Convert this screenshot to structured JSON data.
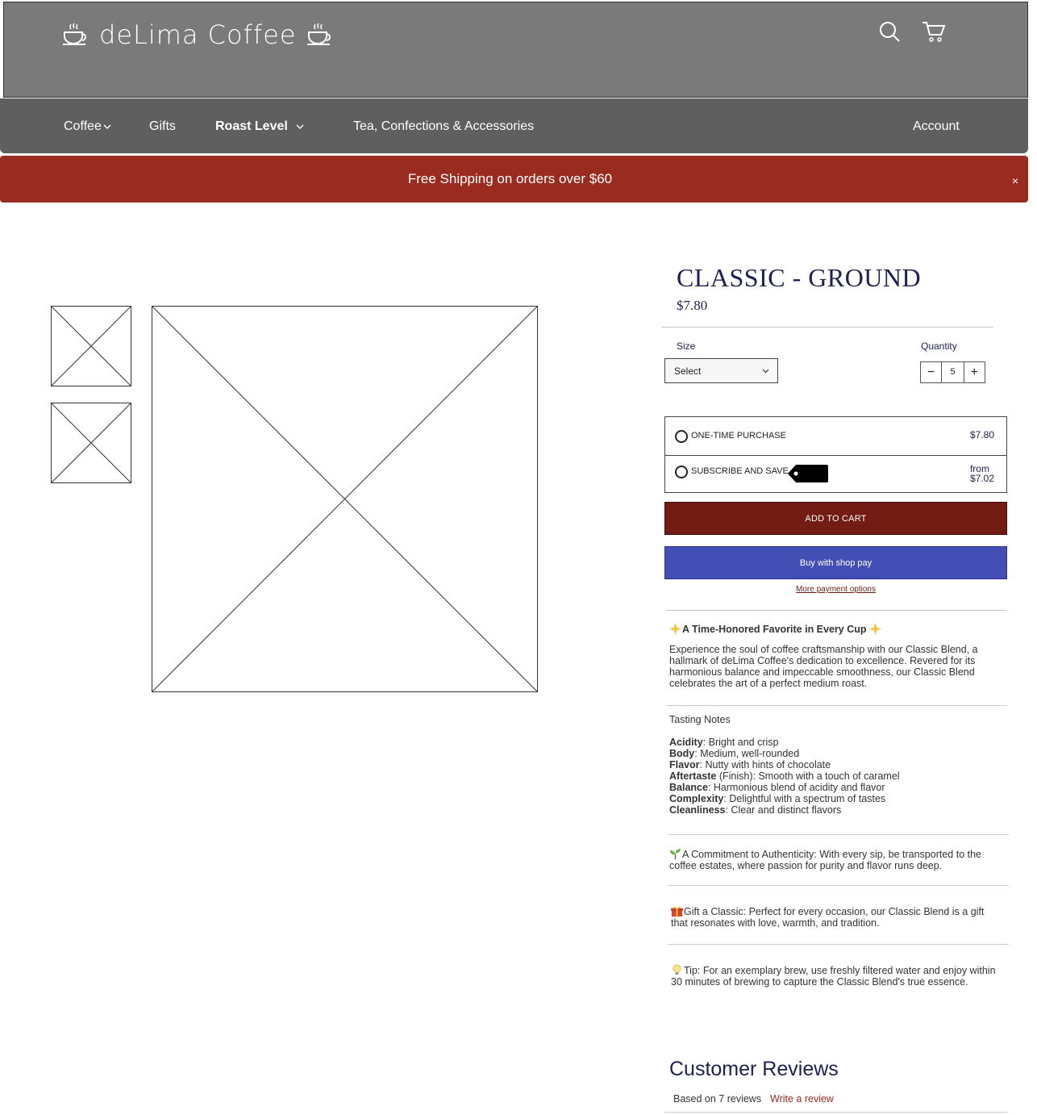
{
  "header": {
    "logo_text": "deLima Coffee",
    "search_icon": "search-icon",
    "cart_icon": "cart-icon",
    "background_color": "#7a7a7a"
  },
  "nav": {
    "items": [
      {
        "label": "Coffee",
        "has_dropdown": true
      },
      {
        "label": "Gifts",
        "has_dropdown": false
      },
      {
        "label": "Roast Level",
        "has_dropdown": true
      },
      {
        "label": "Tea, Confections & Accessories",
        "has_dropdown": false
      }
    ],
    "account_label": "Account"
  },
  "announcement": {
    "text": "Free Shipping on orders over $60",
    "close_label": "×",
    "color": "#9a2b20"
  },
  "product": {
    "title": "CLASSIC - GROUND",
    "price": "$7.80",
    "size_label": "Size",
    "size_value": "Select",
    "quantity_label": "Quantity",
    "quantity_value": "5",
    "quantity_minus": "−",
    "quantity_plus": "+",
    "purchase_options": [
      {
        "label": "ONE-TIME PURCHASE",
        "price": "$7.80"
      },
      {
        "label": "SUBSCRIBE AND SAVE",
        "price_prefix": "from",
        "price": "$7.02"
      }
    ],
    "add_to_cart_label": "ADD TO CART",
    "shop_pay_label": "Buy with shop pay",
    "more_payment_label": "More payment options",
    "accent_color": "#731c14",
    "shop_pay_color": "#434fb5"
  },
  "description": {
    "headline": "A Time-Honored Favorite in Every Cup",
    "intro": "Experience the soul of coffee craftsmanship with our Classic Blend, a hallmark of deLima Coffee's dedication to excellence. Revered for its harmonious balance and impeccable smoothness, our Classic Blend celebrates the art of a perfect medium roast.",
    "tasting_title": "Tasting Notes",
    "tasting_notes": [
      {
        "name": "Acidity",
        "extra": "",
        "value": ": Bright and crisp"
      },
      {
        "name": "Body",
        "extra": "",
        "value": ": Medium, well-rounded"
      },
      {
        "name": "Flavor",
        "extra": "",
        "value": ": Nutty with hints of chocolate"
      },
      {
        "name": "Aftertaste",
        "extra": " (Finish)",
        "value": ": Smooth with a touch of caramel"
      },
      {
        "name": "Balance",
        "extra": "",
        "value": ": Harmonious blend of acidity and flavor"
      },
      {
        "name": "Complexity",
        "extra": "",
        "value": ": Delightful with a spectrum of tastes"
      },
      {
        "name": "Cleanliness",
        "extra": "",
        "value": ": Clear and distinct flavors"
      }
    ],
    "authenticity": "A Commitment to Authenticity: With every sip, be transported to the coffee estates, where passion for purity and flavor runs deep.",
    "gift": "Gift a Classic: Perfect for every occasion, our Classic Blend is a gift that resonates with love, warmth, and tradition.",
    "tip": "Tip: For an exemplary brew, use freshly filtered water and enjoy within 30 minutes of brewing to capture the Classic Blend's true essence."
  },
  "reviews": {
    "title": "Customer Reviews",
    "summary": "Based on 7 reviews",
    "write_label": "Write a review"
  }
}
